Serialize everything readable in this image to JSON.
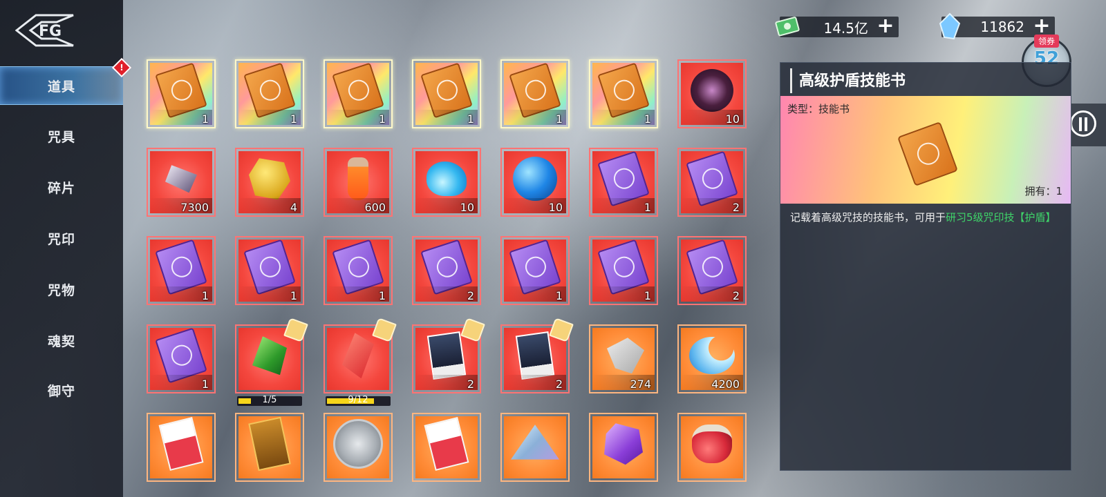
{
  "sidebar": {
    "items": [
      {
        "label": "道具",
        "active": true
      },
      {
        "label": "咒具"
      },
      {
        "label": "碎片"
      },
      {
        "label": "咒印"
      },
      {
        "label": "咒物"
      },
      {
        "label": "魂契"
      },
      {
        "label": "御守"
      }
    ],
    "alert_mark": "!"
  },
  "currency": {
    "cash": {
      "value": "14.5亿",
      "icon": "cash-icon"
    },
    "gem": {
      "value": "11862",
      "icon": "crystal-icon"
    }
  },
  "coupon": {
    "tag": "领券",
    "value": "52"
  },
  "inventory": {
    "rows": [
      [
        {
          "icon": "orange-skill-book",
          "quality": "gold",
          "count": "1"
        },
        {
          "icon": "orange-skill-book",
          "quality": "gold",
          "count": "1"
        },
        {
          "icon": "orange-skill-book",
          "quality": "gold",
          "count": "1"
        },
        {
          "icon": "orange-skill-book",
          "quality": "gold",
          "count": "1"
        },
        {
          "icon": "orange-skill-book",
          "quality": "gold",
          "count": "1"
        },
        {
          "icon": "orange-skill-book",
          "quality": "gold",
          "count": "1"
        },
        {
          "icon": "dark-gem",
          "quality": "red",
          "count": "10"
        }
      ],
      [
        {
          "icon": "crystal",
          "quality": "red",
          "count": "7300"
        },
        {
          "icon": "gold-nugget",
          "quality": "red",
          "count": "4"
        },
        {
          "icon": "potion",
          "quality": "red",
          "count": "600"
        },
        {
          "icon": "blue-flame",
          "quality": "red",
          "count": "10"
        },
        {
          "icon": "blue-orb",
          "quality": "red",
          "count": "10"
        },
        {
          "icon": "purple-skill-book",
          "quality": "red",
          "count": "1"
        },
        {
          "icon": "purple-skill-book",
          "quality": "red",
          "count": "2"
        }
      ],
      [
        {
          "icon": "purple-skill-book",
          "quality": "red",
          "count": "1"
        },
        {
          "icon": "purple-skill-book",
          "quality": "red",
          "count": "1"
        },
        {
          "icon": "purple-skill-book",
          "quality": "red",
          "count": "1"
        },
        {
          "icon": "purple-skill-book",
          "quality": "red",
          "count": "2"
        },
        {
          "icon": "purple-skill-book",
          "quality": "red",
          "count": "1"
        },
        {
          "icon": "purple-skill-book",
          "quality": "red",
          "count": "1"
        },
        {
          "icon": "purple-skill-book",
          "quality": "red",
          "count": "2"
        }
      ],
      [
        {
          "icon": "purple-skill-book",
          "quality": "red",
          "count": "1"
        },
        {
          "icon": "emerald-fragment",
          "quality": "red",
          "count": "",
          "puzzle": true,
          "progress": {
            "text": "1/5",
            "ratio": 0.2
          }
        },
        {
          "icon": "red-shard",
          "quality": "red",
          "count": "",
          "puzzle": true,
          "progress": {
            "text": "9/12",
            "ratio": 0.75
          }
        },
        {
          "icon": "character-card",
          "quality": "red",
          "count": "2",
          "puzzle": true
        },
        {
          "icon": "character-card",
          "quality": "red",
          "count": "2",
          "puzzle": true
        },
        {
          "icon": "silver-key",
          "quality": "orange",
          "count": "274"
        },
        {
          "icon": "crescent-crystal",
          "quality": "orange",
          "count": "4200"
        }
      ],
      [
        {
          "icon": "ticket",
          "quality": "orange",
          "count": ""
        },
        {
          "icon": "scroll",
          "quality": "orange",
          "count": ""
        },
        {
          "icon": "hexagram-medal",
          "quality": "orange",
          "count": ""
        },
        {
          "icon": "ticket",
          "quality": "orange",
          "count": ""
        },
        {
          "icon": "crystal-pyramid",
          "quality": "orange",
          "count": ""
        },
        {
          "icon": "amethyst",
          "quality": "orange",
          "count": ""
        },
        {
          "icon": "red-jar",
          "quality": "orange",
          "count": ""
        }
      ]
    ]
  },
  "detail": {
    "title": "高级护盾技能书",
    "type_label": "类型：技能书",
    "owned_label": "拥有：1",
    "desc_prefix": "记载着高级咒技的技能书，可用于",
    "desc_highlight": "研习5级咒印技【护盾】"
  },
  "colors": {
    "highlight": "#3fd66a",
    "active_nav": "#4a90d0"
  }
}
